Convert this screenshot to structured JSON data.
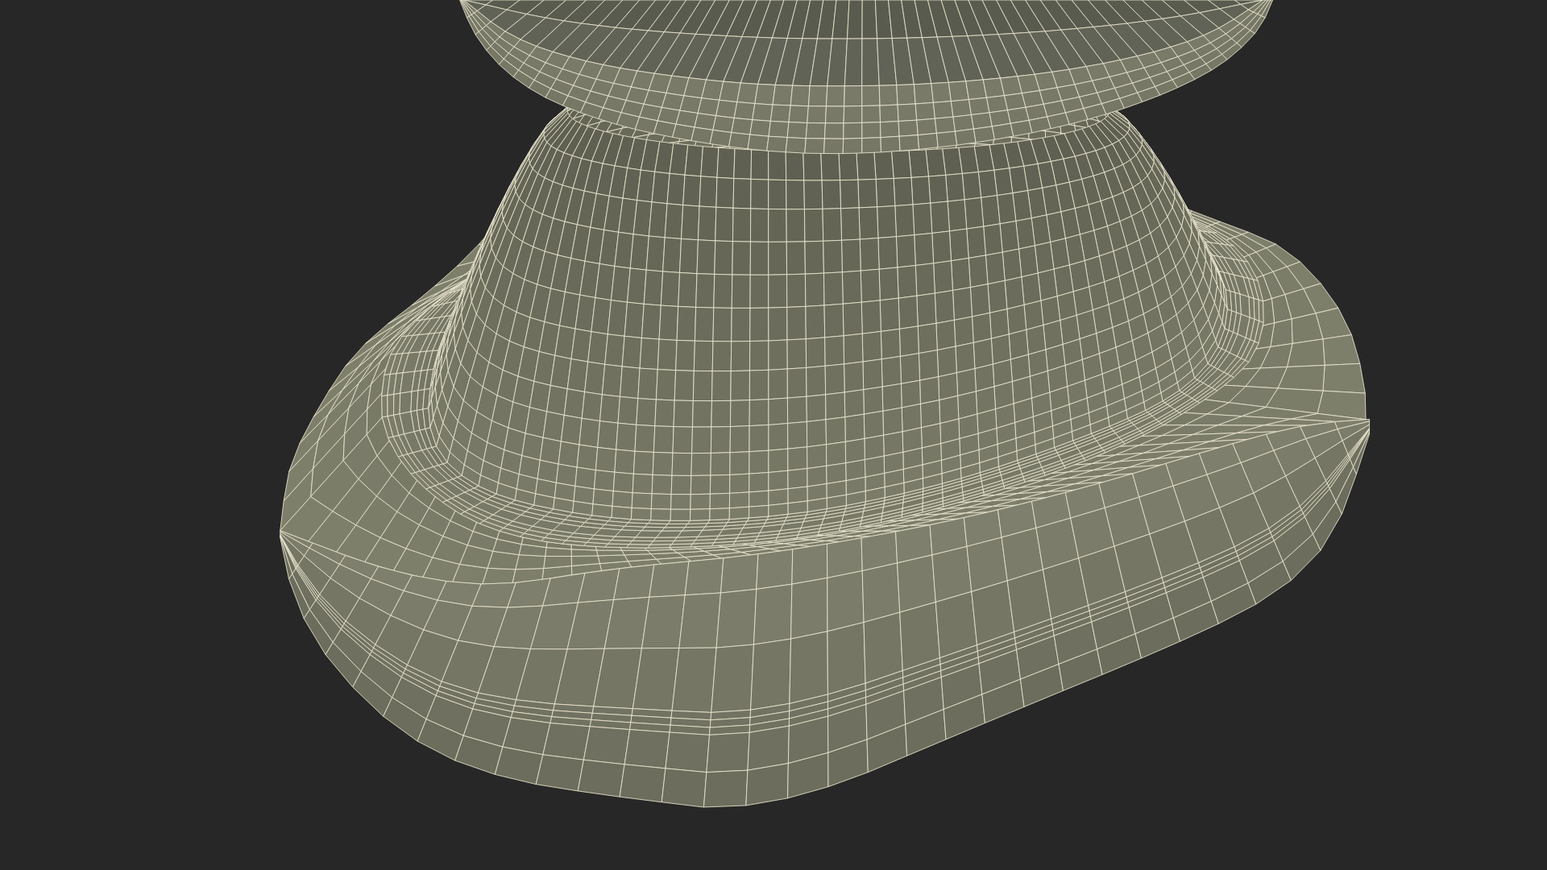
{
  "viewport": {
    "model_parts": [
      {
        "kind": "base"
      },
      {
        "kind": "ledge"
      },
      {
        "kind": "neck"
      },
      {
        "kind": "disc"
      }
    ]
  }
}
